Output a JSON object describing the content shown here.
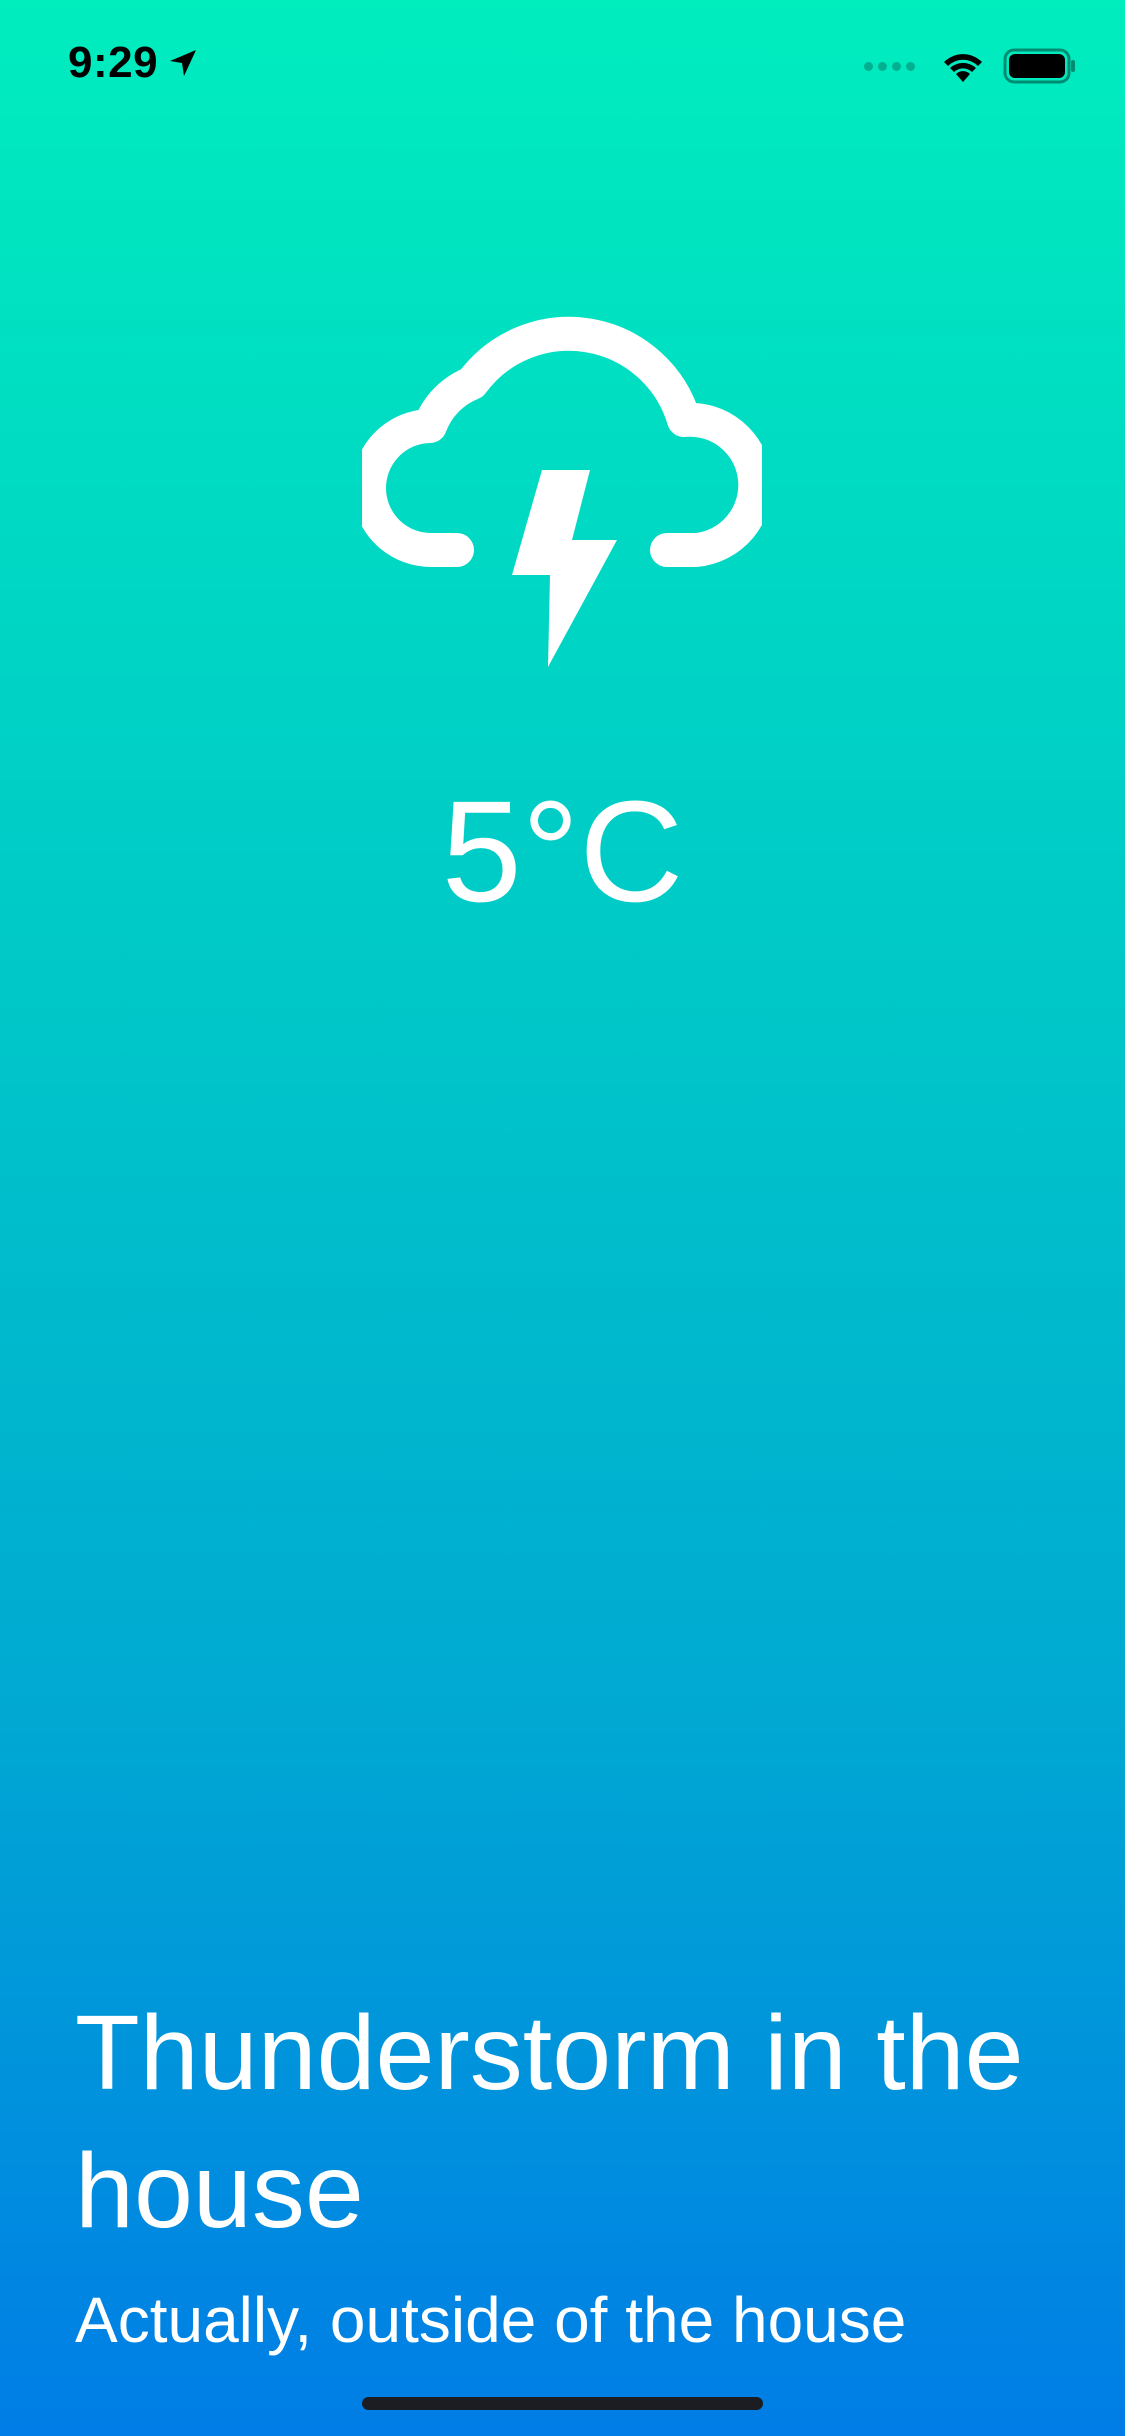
{
  "status_bar": {
    "time": "9:29",
    "location_icon": "location-arrow-icon",
    "signal_icon": "cellular-signal-icon",
    "wifi_icon": "wifi-icon",
    "battery_icon": "battery-icon"
  },
  "weather": {
    "icon": "thunderstorm-cloud-icon",
    "temperature": "5°C",
    "headline": "Thunderstorm in the house",
    "subline": "Actually, outside of the house"
  },
  "colors": {
    "gradient_top": "#00EDBE",
    "gradient_bottom": "#007DE6",
    "text": "#FFFFFF"
  }
}
